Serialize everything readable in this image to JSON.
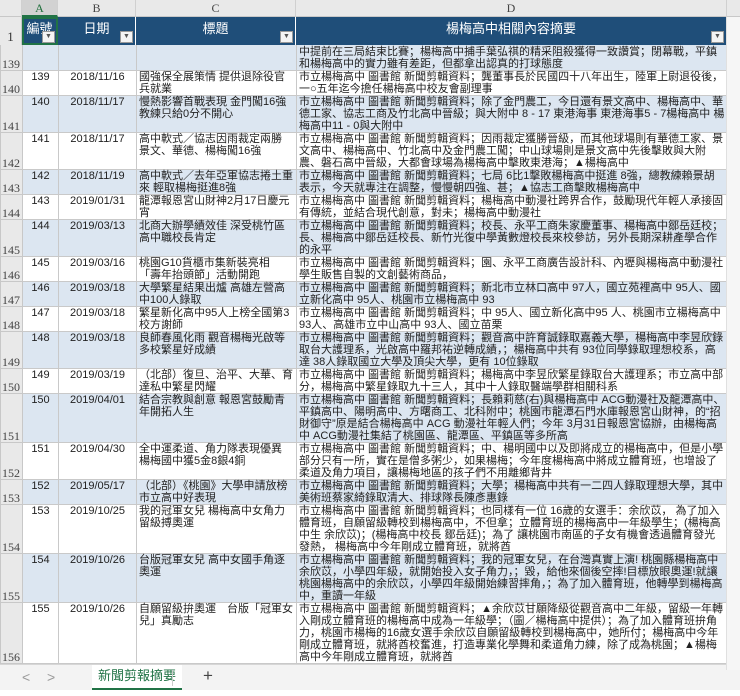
{
  "columns": {
    "row_corner": "",
    "a": "A",
    "b": "B",
    "c": "C",
    "d": "D"
  },
  "header": {
    "row_number": "1",
    "num": "編號",
    "date": "日期",
    "title": "標題",
    "summary": "楊梅高中相關內容摘要",
    "filter_icon": "▼"
  },
  "rows": [
    {
      "row": "139",
      "num": "",
      "date": "",
      "title": "中拼出殺劃3局",
      "summary": "的中類高中，則在嗣晉戰以 20 : 0 於 3 局扣倒對手楊梅高中，楊梅高中（前）被中類高中提前在三局結束比賽；楊梅高中捕手葉弘祺的精采阻殺獲得一致讚賞；閉幕戰，平鎮和楊梅高中的實力雖有差距，但都拿出認真的打球態度"
    },
    {
      "row": "140",
      "num": "139",
      "date": "2018/11/16",
      "title": "國強保全展策情 提供退除役官兵就業",
      "summary": "市立楊梅高中 圖書館 新聞剪輯資料；龔董事長於民國四十八年出生，陸軍上尉退役後，一○五年迄今擔任楊梅高中校友會副理事"
    },
    {
      "row": "141",
      "num": "140",
      "date": "2018/11/17",
      "title": "慢熱影響首戰表現 金門闖16強教練只給0分不開心",
      "summary": "市立楊梅高中 圖書館 新聞剪輯資料；除了金門農工，今日還有景文高中、楊梅高中、華德工家、協志工商及竹北高中晉級；與大附中 8 - 17 東港海事 東港海事5 - 7楊梅高中 楊梅高中11 - 0與大附中"
    },
    {
      "row": "142",
      "num": "141",
      "date": "2018/11/17",
      "title": "高中軟式／協志因雨裁定兩勝　景文、華德、楊梅闖16強",
      "summary": "市立楊梅高中 圖書館 新聞剪輯資料；因雨裁定獲勝晉級，而其他球場則有華德工家、景文高中、楊梅高中、竹北高中及金門農工闖；中山球場則是景文高中先後擊敗與大附農、磐石高中晉級，大都會球場為楊梅高中擊敗東港海；▲楊梅高中"
    },
    {
      "row": "143",
      "num": "142",
      "date": "2018/11/19",
      "title": "高中軟式／去年亞軍協志捲土重來 輕取楊梅挺進8強",
      "summary": "市立楊梅高中 圖書館 新聞剪輯資料；七局 6比1擊敗楊梅高中挺進 8強，總教練賴景胡表示，今天就專注在調整，慢慢朝四強、甚；▲協志工商擊敗楊梅高中"
    },
    {
      "row": "144",
      "num": "143",
      "date": "2019/01/31",
      "title": "龍潭報恩宮山財神2月17日慶元宵",
      "summary": "市立楊梅高中 圖書館 新聞剪輯資料；楊梅高中動漫社跨界合作，鼓勵現代年輕人承接固有傳統，並結合現代創意，對未；楊梅高中動漫社"
    },
    {
      "row": "145",
      "num": "144",
      "date": "2019/03/13",
      "title": "北商大辦學績效佳 深受桃竹區高中職校長肯定",
      "summary": "市立楊梅高中 圖書館 新聞剪輯資料；校長、永平工商朱家慶董事、楊梅高中鄒岳廷校；長、楊梅高中鄒岳廷校長、新竹光復中學黃數燈校長來校參訪，另外長期深耕產學合作的永平"
    },
    {
      "row": "146",
      "num": "145",
      "date": "2019/03/16",
      "title": "桃園G10貨櫃市集新裝亮相 「壽年抬頭節」活動開跑",
      "summary": "市立楊梅高中 圖書館 新聞剪輯資料；園、永平工商廣告設計科、內壢與楊梅高中動漫社學生販售自製的文創藝術商品，"
    },
    {
      "row": "147",
      "num": "146",
      "date": "2019/03/18",
      "title": "大學繁星結果出爐 高雄左營高中100人錄取",
      "summary": "市立楊梅高中 圖書館 新聞剪輯資料；新北市立林口高中 97人，國立苑裡高中 95人、國立新化高中 95人、桃園市立楊梅高中 93"
    },
    {
      "row": "148",
      "num": "147",
      "date": "2019/03/18",
      "title": "繁星新化高中95人上榜全國第3 校方謝師",
      "summary": "市立楊梅高中 圖書館 新聞剪輯資料；中 95人、國立新化高中95 人、桃園市立楊梅高中 93人、高雄市立中山高中 93人、國立苗栗"
    },
    {
      "row": "149",
      "num": "148",
      "date": "2019/03/18",
      "title": "良師春風化雨 觀音楊梅光啟等多校繁星好成績",
      "summary": "市立楊梅高中 圖書館 新聞剪輯資料；觀音高中許育誠錄取嘉義大學，楊梅高中李昱欣錄取台大護理系，光啟高中羅邦祐逆轉成績，；楊梅高中共有 93位同學錄取理想校系，高達 38人錄取國立大學及頂尖大學，更有 10位錄取"
    },
    {
      "row": "150",
      "num": "149",
      "date": "2019/03/19",
      "title": "（北部）復旦、治平、大華、育達私中繁星閃耀",
      "summary": "市立楊梅高中 圖書館 新聞剪輯資料；楊梅高中李昱欣繁星錄取台大護理系；市立高中部分，楊梅高中繁星錄取九十三人，其中十人錄取醫端學群相關科系"
    },
    {
      "row": "151",
      "num": "150",
      "date": "2019/04/01",
      "title": "結合宗教與創意 報恩宮鼓勵青年開拓人生",
      "summary": "市立楊梅高中 圖書館 新聞剪輯資料；長賴莉慈(右)與楊梅高中 ACG動漫社及龍潭高中、平鎮高中、陽明高中、方曙商工、北科附中；桃園市龍潭石門水庫報恩宮山財神，的“招財御守”原是結合楊梅高中 ACG 動漫社年輕人們；今年 3月31日報恩宮協辦，由楊梅高中 ACG動漫社集結了桃園區、龍潭區、平鎮區等多所高"
    },
    {
      "row": "152",
      "num": "151",
      "date": "2019/04/30",
      "title": "全中運柔道、角力隊表現優異 楊梅國中獲5金8銀4銅",
      "summary": "市立楊梅高中 圖書館 新聞剪輯資料；中、楊明國中以及即將成立的楊梅高中，但是小學部分只有一所，實在是僧多粥少，如果楊梅；今年度楊梅高中將成立體育班，也增設了柔道及角力項目，讓楊梅地區的孩子們不用離鄉背井"
    },
    {
      "row": "153",
      "num": "152",
      "date": "2019/05/17",
      "title": "（北部）《桃園》大學申請放榜 市立高中好表現",
      "summary": "市立楊梅高中 圖書館 新聞剪輯資料；大學；楊梅高中共有一二四人錄取理想大學，其中美術班蔡家綺錄取清大、排球隊長陳彥惠錄"
    },
    {
      "row": "154",
      "num": "153",
      "date": "2019/10/25",
      "title": "我的冠軍女兒 楊梅高中女角力留級搏奧運",
      "summary": "市立楊梅高中 圖書館 新聞剪輯資料；也同樣有一位 16歲的女選手：余欣苡， 為了加入體育班，自願留級轉校到楊梅高中，不但拿；立體育班的楊梅高中一年級學生；(楊梅高中生 余欣苡)；(楊梅高中校長 鄒岳廷)；為了 讓桃園市南區的子女有機會透過體育發光發熱， 楊梅高中今年剛成立體育班，就將酋"
    },
    {
      "row": "155",
      "num": "154",
      "date": "2019/10/26",
      "title": "台版冠軍女兒 高中女國手角逐奧運",
      "summary": "市立楊梅高中 圖書館 新聞剪輯資料；我的冠軍女兒，在台灣真實上演! 桃園縣楊梅高中余欣苡，小學四年級，就開始投入女子角力，；毀，給他來個後空摔!目標放眼奧運!就讓桃園楊梅高中的余欣苡，小學四年級開始練習摔角，；為了加入體育班，他轉學到楊梅高中，重讀一年級"
    },
    {
      "row": "156",
      "num": "155",
      "date": "2019/10/26",
      "title": "自願留級拚奧運　台版「冠軍女兒」真勵志",
      "summary": "市立楊梅高中 圖書館 新聞剪輯資料；▲余欣苡甘願降級從觀音高中二年級，留級一年轉入剛成立體育班的楊梅高中成為一年級學；（圖／楊梅高中提供）；為了加入體育班拚角力，桃園市楊梅的16歲女選手余欣苡自願留級轉校到楊梅高中，她所付；楊梅高中今年剛成立體育班，就將酋校奮進，打造專業化學舞和柔道角力練，除了成為桃園；▲楊梅高中今年剛成立體育班，就將酋"
    }
  ],
  "sheet_tabs": {
    "prev": "<",
    "next": ">",
    "active": "新聞剪報摘要",
    "add": "+"
  },
  "colors": {
    "header_bg": "#1f4e79",
    "band": "#dce6f1",
    "accent": "#217346"
  }
}
